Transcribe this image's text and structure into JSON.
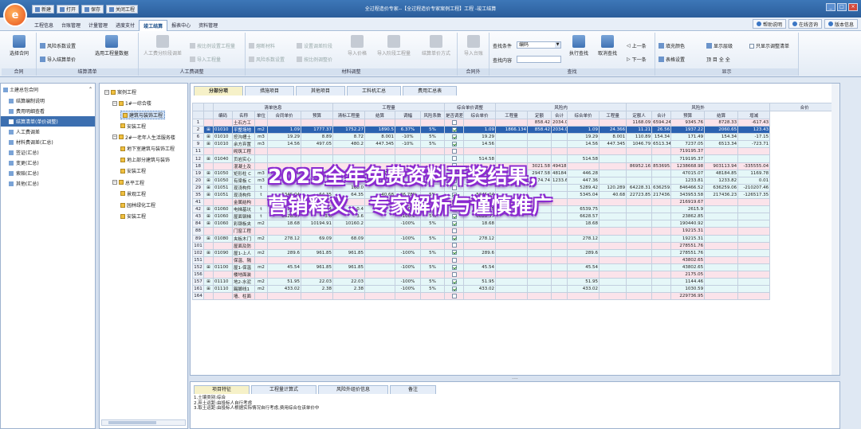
{
  "app": {
    "window_title": "全过程造价专家--【全过程造价专家案例工程】工程 -竣工结算",
    "logo_glyph": "e"
  },
  "qat": [
    {
      "label": "新建"
    },
    {
      "label": "打开"
    },
    {
      "label": "保存"
    },
    {
      "label": "关闭工程"
    }
  ],
  "menu": [
    {
      "label": "工程信息",
      "active": false
    },
    {
      "label": "台账管理",
      "active": false
    },
    {
      "label": "计量管理",
      "active": false
    },
    {
      "label": "进度支付",
      "active": false
    },
    {
      "label": "竣工结算",
      "active": true
    },
    {
      "label": "报表中心",
      "active": false
    },
    {
      "label": "资料管理",
      "active": false
    }
  ],
  "top_right": [
    {
      "label": "帮助说明"
    },
    {
      "label": "在线咨询"
    },
    {
      "label": "版本信息"
    }
  ],
  "ribbon": {
    "groups": [
      "合同",
      "结算清单",
      "人工费调整",
      "材料调整",
      "合同外",
      "查找",
      "显示"
    ],
    "select_contract": "选择合同",
    "risk_coef": "风险系数设置",
    "import_unit_price": "导入结算单价",
    "select_qty_data": "选用工程量数据",
    "labor_ratio": "人工费分阶段调差",
    "import_engineering": "导入工程量",
    "set_labor_stage": "按比例设置工程量",
    "labor_price": "按比例调整工程量",
    "fuse_material": "熔断材料",
    "material_risk": "风险系数设置",
    "set_adjust_stage": "设置调差阶段",
    "adjust_by_ratio": "按比例调整价",
    "import_price": "导入价格",
    "import_stage_qty": "导入阶段工程量",
    "calc_method": "结算单价方式",
    "import_outside": "导入台账",
    "find_cond_label": "查找条件",
    "find_cond_value": "编码",
    "find_content_label": "查找内容",
    "find_content_value": "",
    "exec_find": "执行查找",
    "cancel_find": "取消查找",
    "prev": "上一条",
    "next": "下一条",
    "fill_color": "填充颜色",
    "table_settings": "表格设置",
    "show_level": "显示层级",
    "level_buttons": "顶 目 全 全",
    "only_show_adjust": "只显示调整清单"
  },
  "left_panel": {
    "root": "土建总包合同",
    "items": [
      {
        "label": "结算编制说明",
        "active": false
      },
      {
        "label": "费用明细查看",
        "active": false
      },
      {
        "label": "结算清单(单价调整)",
        "active": true
      },
      {
        "label": "人工费调差",
        "active": false
      },
      {
        "label": "材料费调差(汇总)",
        "active": false
      },
      {
        "label": "签证(汇总)",
        "active": false
      },
      {
        "label": "变更(汇总)",
        "active": false
      },
      {
        "label": "索赔(汇总)",
        "active": false
      },
      {
        "label": "其他(汇总)",
        "active": false
      }
    ]
  },
  "tree": {
    "nodes": [
      {
        "label": "案例工程",
        "level": 0,
        "exp": "−"
      },
      {
        "label": "1#一综合楼",
        "level": 1,
        "exp": "−"
      },
      {
        "label": "建筑与装饰工程",
        "level": 2,
        "exp": "",
        "selected": true
      },
      {
        "label": "安装工程",
        "level": 2,
        "exp": ""
      },
      {
        "label": "2#一老年人生活服务楼",
        "level": 1,
        "exp": "−"
      },
      {
        "label": "地下室建筑与装饰工程",
        "level": 2,
        "exp": ""
      },
      {
        "label": "地上部分建筑与装饰",
        "level": 2,
        "exp": ""
      },
      {
        "label": "安装工程",
        "level": 2,
        "exp": ""
      },
      {
        "label": "总平工程",
        "level": 1,
        "exp": "−"
      },
      {
        "label": "景观工程",
        "level": 2,
        "exp": ""
      },
      {
        "label": "园林绿化工程",
        "level": 2,
        "exp": ""
      },
      {
        "label": "安装工程",
        "level": 2,
        "exp": ""
      }
    ]
  },
  "tabs": [
    {
      "label": "分部分项",
      "active": true
    },
    {
      "label": "措施项目",
      "active": false
    },
    {
      "label": "其他项目",
      "active": false
    },
    {
      "label": "工料机汇总",
      "active": false
    },
    {
      "label": "费用汇总表",
      "active": false
    }
  ],
  "table": {
    "group_headers": [
      {
        "label": "清单信息",
        "span": 5
      },
      {
        "label": "工程量",
        "span": 4
      },
      {
        "label": "综合单价调整",
        "span": 2
      },
      {
        "label": "风险内",
        "span": 5
      },
      {
        "label": "风险外",
        "span": 5
      },
      {
        "label": "合价",
        "span": 3
      }
    ],
    "headers": [
      "编码",
      "名称",
      "单位",
      "合同单价",
      "预算",
      "清标工程量",
      "结算",
      "调幅",
      "风险系数",
      "是否调差",
      "综合单价",
      "工程量",
      "定额",
      "合计",
      "综合单价",
      "工程量",
      "定额人",
      "合计",
      "预算",
      "结算",
      "增减"
    ],
    "rows": [
      {
        "n": "1",
        "style": "pink",
        "exp": "",
        "cells": [
          "",
          "土石方工",
          "",
          "",
          "",
          "",
          "",
          "",
          "",
          "",
          "",
          "",
          "858.42",
          "2034.0",
          "",
          "",
          "1168.09",
          "6594.24",
          "9345.76",
          "8728.33",
          "-617.43"
        ]
      },
      {
        "n": "2",
        "style": "sel",
        "exp": "⊞",
        "cells": [
          "01010",
          "平整场地",
          "m2",
          "1.09",
          "1777.37",
          "1752.27",
          "1890.5",
          "6.37%",
          "5%",
          "✓",
          "1.09",
          "1866.134",
          "858.42",
          "2034.0",
          "1.09",
          "24.366",
          "11.21",
          "26.56",
          "1937.22",
          "2060.65",
          "123.43"
        ]
      },
      {
        "n": "6",
        "style": "cyan",
        "exp": "⊞",
        "cells": [
          "01010",
          "挖沟槽土",
          "m3",
          "19.29",
          "8.89",
          "8.72",
          "8.001",
          "-10%",
          "5%",
          "✓",
          "19.29",
          "",
          "",
          "",
          "19.29",
          "8.001",
          "110.89",
          "154.34",
          "171.49",
          "154.34",
          "-17.15"
        ]
      },
      {
        "n": "9",
        "style": "cyan",
        "exp": "⊞",
        "cells": [
          "01010",
          "余方弃置",
          "m3",
          "14.56",
          "497.05",
          "480.2",
          "447.345",
          "-10%",
          "5%",
          "✓",
          "14.56",
          "",
          "",
          "",
          "14.56",
          "447.345",
          "1046.79",
          "6513.34",
          "7237.05",
          "6513.34",
          "-723.71"
        ]
      },
      {
        "n": "11",
        "style": "pink",
        "exp": "",
        "cells": [
          "",
          "砌筑工程",
          "",
          "",
          "",
          "",
          "",
          "",
          "",
          "",
          "",
          "",
          "",
          "",
          "",
          "",
          "",
          "",
          "719195.37",
          "",
          ""
        ]
      },
      {
        "n": "12",
        "style": "cyan",
        "exp": "⊞",
        "cells": [
          "01040",
          "页岩实心",
          "",
          "",
          "",
          "",
          "",
          "",
          "",
          "",
          "514.58",
          "",
          "",
          "",
          "514.58",
          "",
          "",
          "",
          "719195.37",
          "",
          ""
        ]
      },
      {
        "n": "18",
        "style": "pink",
        "exp": "",
        "cells": [
          "",
          "混凝土及",
          "",
          "",
          "",
          "",
          "",
          "",
          "",
          "",
          "",
          "",
          "3021.58",
          "49418.",
          "",
          "",
          "86952.16",
          "853695.",
          "1238668.98",
          "903113.94",
          "-335555.04"
        ]
      },
      {
        "n": "19",
        "style": "cyan",
        "exp": "⊞",
        "cells": [
          "01050",
          "矩形柱 C",
          "m3",
          "446.28",
          "105.35",
          "103.1",
          "107.97",
          "2.49%",
          "5%",
          "",
          "446.28",
          "107.97",
          "2947.58",
          "48184.",
          "446.28",
          "",
          "",
          "",
          "47015.07",
          "48184.85",
          "1169.78"
        ]
      },
      {
        "n": "20",
        "style": "cyan",
        "exp": "⊞",
        "cells": [
          "01050",
          "有梁板 C",
          "m3",
          "447.36",
          "",
          "",
          "",
          "",
          "5%",
          "",
          "447.36",
          "",
          "74.74",
          "1233.6",
          "447.36",
          "",
          "",
          "",
          "1233.81",
          "1233.82",
          "0.01"
        ]
      },
      {
        "n": "29",
        "style": "cyan",
        "exp": "⊞",
        "cells": [
          "01051",
          "现浇构件",
          "t",
          "",
          "",
          "160.0",
          "",
          "",
          "",
          "",
          "",
          "",
          "",
          "",
          "5289.42",
          "120.289",
          "64228.31",
          "636259.0",
          "846466.52",
          "636259.06",
          "-210207.46"
        ]
      },
      {
        "n": "35",
        "style": "cyan",
        "exp": "⊞",
        "cells": [
          "01051",
          "现浇构件",
          "t",
          "5345.04",
          "64.35",
          "64.35",
          "40.68",
          "-36.78%",
          "5%",
          "✓",
          "5345.04",
          "",
          "",
          "",
          "5345.04",
          "40.68",
          "22723.85",
          "217436.",
          "343953.58",
          "217436.23",
          "-126517.35"
        ]
      },
      {
        "n": "41",
        "style": "pink",
        "exp": "",
        "cells": [
          "",
          "金属结构",
          "",
          "",
          "",
          "",
          "",
          "",
          "",
          "",
          "",
          "",
          "",
          "",
          "",
          "",
          "",
          "",
          "216919.67",
          "",
          ""
        ]
      },
      {
        "n": "42",
        "style": "cyan",
        "exp": "⊞",
        "cells": [
          "01060",
          "电梯基坑",
          "t",
          "6539.75",
          "0.4",
          "0.4",
          "",
          "-100%",
          "5%",
          "✓",
          "6539.75",
          "",
          "",
          "",
          "6539.75",
          "",
          "",
          "",
          "2615.9",
          "",
          ""
        ]
      },
      {
        "n": "43",
        "style": "cyan",
        "exp": "⊞",
        "cells": [
          "01060",
          "屋面钢梯",
          "t",
          "6628.57",
          "3.6",
          "3.6",
          "",
          "-100%",
          "5%",
          "✓",
          "6628.57",
          "",
          "",
          "",
          "6628.57",
          "",
          "",
          "",
          "23862.85",
          "",
          ""
        ]
      },
      {
        "n": "84",
        "style": "cyan",
        "exp": "⊞",
        "cells": [
          "01060",
          "彩钢板夹",
          "m2",
          "18.68",
          "10194.91",
          "10160.2",
          "",
          "-100%",
          "5%",
          "✓",
          "18.68",
          "",
          "",
          "",
          "18.68",
          "",
          "",
          "",
          "190440.92",
          "",
          ""
        ]
      },
      {
        "n": "88",
        "style": "pink",
        "exp": "",
        "cells": [
          "",
          "门窗工程",
          "",
          "",
          "",
          "",
          "",
          "",
          "",
          "",
          "",
          "",
          "",
          "",
          "",
          "",
          "",
          "",
          "19215.31",
          "",
          ""
        ]
      },
      {
        "n": "89",
        "style": "cyan",
        "exp": "⊞",
        "cells": [
          "01080",
          "夹板木门",
          "m2",
          "278.12",
          "69.09",
          "68.09",
          "",
          "-100%",
          "5%",
          "✓",
          "278.12",
          "",
          "",
          "",
          "278.12",
          "",
          "",
          "",
          "19215.31",
          "",
          ""
        ]
      },
      {
        "n": "101",
        "style": "pink",
        "exp": "",
        "cells": [
          "",
          "屋面及防",
          "",
          "",
          "",
          "",
          "",
          "",
          "",
          "",
          "",
          "",
          "",
          "",
          "",
          "",
          "",
          "",
          "278551.76",
          "",
          ""
        ]
      },
      {
        "n": "102",
        "style": "cyan",
        "exp": "⊞",
        "cells": [
          "01090",
          "屋1-上人",
          "m2",
          "289.6",
          "961.85",
          "961.85",
          "",
          "-100%",
          "5%",
          "✓",
          "289.6",
          "",
          "",
          "",
          "289.6",
          "",
          "",
          "",
          "278551.76",
          "",
          ""
        ]
      },
      {
        "n": "151",
        "style": "pink",
        "exp": "",
        "cells": [
          "",
          "保温、隔",
          "",
          "",
          "",
          "",
          "",
          "",
          "",
          "",
          "",
          "",
          "",
          "",
          "",
          "",
          "",
          "",
          "43802.65",
          "",
          ""
        ]
      },
      {
        "n": "152",
        "style": "cyan",
        "exp": "⊞",
        "cells": [
          "01100",
          "屋1-保温",
          "m2",
          "45.54",
          "961.85",
          "961.85",
          "",
          "-100%",
          "5%",
          "✓",
          "45.54",
          "",
          "",
          "",
          "45.54",
          "",
          "",
          "",
          "43802.65",
          "",
          ""
        ]
      },
      {
        "n": "156",
        "style": "pink",
        "exp": "",
        "cells": [
          "",
          "楼地面装",
          "",
          "",
          "",
          "",
          "",
          "",
          "",
          "",
          "",
          "",
          "",
          "",
          "",
          "",
          "",
          "",
          "2175.05",
          "",
          ""
        ]
      },
      {
        "n": "157",
        "style": "cyan",
        "exp": "⊞",
        "cells": [
          "01110",
          "地2-水泥",
          "m2",
          "51.95",
          "22.03",
          "22.03",
          "",
          "-100%",
          "5%",
          "✓",
          "51.95",
          "",
          "",
          "",
          "51.95",
          "",
          "",
          "",
          "1144.46",
          "",
          ""
        ]
      },
      {
        "n": "161",
        "style": "cyan",
        "exp": "⊞",
        "cells": [
          "01110",
          "踢脚线1",
          "m2",
          "433.02",
          "2.38",
          "2.38",
          "",
          "-100%",
          "5%",
          "✓",
          "433.02",
          "",
          "",
          "",
          "433.02",
          "",
          "",
          "",
          "1030.59",
          "",
          ""
        ]
      },
      {
        "n": "164",
        "style": "pink",
        "exp": "",
        "cells": [
          "",
          "墙、柱面",
          "",
          "",
          "",
          "",
          "",
          "",
          "",
          "",
          "",
          "",
          "",
          "",
          "",
          "",
          "",
          "",
          "229736.95",
          "",
          ""
        ]
      }
    ]
  },
  "bottom_tabs": [
    {
      "label": "项目特征",
      "active": true
    },
    {
      "label": "工程量计算式",
      "active": false
    },
    {
      "label": "风险外组价信息",
      "active": false
    },
    {
      "label": "备注",
      "active": false
    }
  ],
  "notes": [
    "1.土壤类别:综合",
    "2.弃土运距:由投标人自行考虑",
    "3.取土运距:由投标人根据实际情况自行考虑,费用综合在该单价中"
  ],
  "overlay": {
    "line1": "2025全年免费资料开奖结果，",
    "line2": "营销释义、专家解析与谨慎推广"
  },
  "colors": {
    "selected_row": "#2b62b1",
    "group_row": "#fbe3ea",
    "item_row": "#e5f7f8",
    "overlay_stroke": "#8b2bd0"
  }
}
